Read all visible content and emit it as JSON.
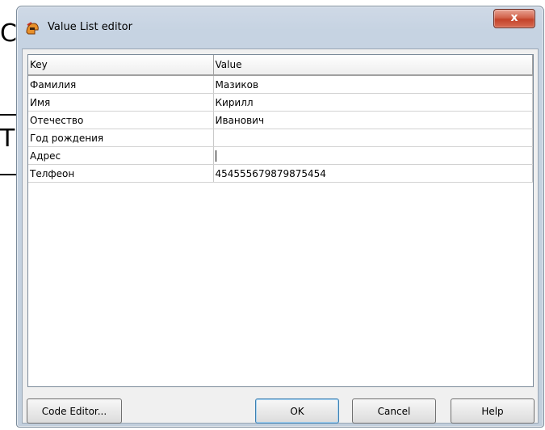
{
  "background": {
    "fragment_1": "С",
    "fragment_2": "Т"
  },
  "window": {
    "title": "Value List editor",
    "close_label": "x"
  },
  "grid": {
    "headers": {
      "key": "Key",
      "value": "Value"
    },
    "rows": [
      {
        "key": "Фамилия",
        "value": "Мазиков"
      },
      {
        "key": "Имя",
        "value": "Кирилл"
      },
      {
        "key": "Отечество",
        "value": "Иванович"
      },
      {
        "key": "Год рождения",
        "value": ""
      },
      {
        "key": "Адрес",
        "value": ""
      },
      {
        "key": "Телфеон",
        "value": "454555679879875454"
      }
    ]
  },
  "buttons": {
    "code_editor": "Code Editor...",
    "ok": "OK",
    "cancel": "Cancel",
    "help": "Help"
  }
}
